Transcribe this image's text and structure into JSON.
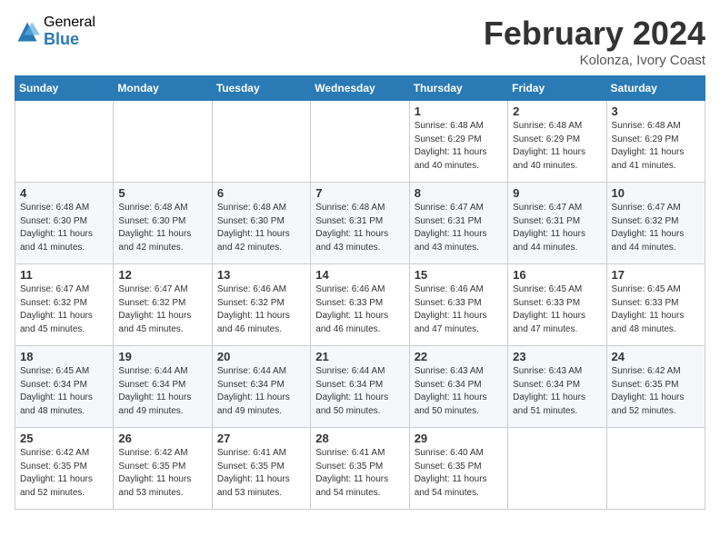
{
  "logo": {
    "general": "General",
    "blue": "Blue"
  },
  "title": "February 2024",
  "subtitle": "Kolonza, Ivory Coast",
  "days_header": [
    "Sunday",
    "Monday",
    "Tuesday",
    "Wednesday",
    "Thursday",
    "Friday",
    "Saturday"
  ],
  "weeks": [
    [
      {
        "day": "",
        "info": ""
      },
      {
        "day": "",
        "info": ""
      },
      {
        "day": "",
        "info": ""
      },
      {
        "day": "",
        "info": ""
      },
      {
        "day": "1",
        "info": "Sunrise: 6:48 AM\nSunset: 6:29 PM\nDaylight: 11 hours\nand 40 minutes."
      },
      {
        "day": "2",
        "info": "Sunrise: 6:48 AM\nSunset: 6:29 PM\nDaylight: 11 hours\nand 40 minutes."
      },
      {
        "day": "3",
        "info": "Sunrise: 6:48 AM\nSunset: 6:29 PM\nDaylight: 11 hours\nand 41 minutes."
      }
    ],
    [
      {
        "day": "4",
        "info": "Sunrise: 6:48 AM\nSunset: 6:30 PM\nDaylight: 11 hours\nand 41 minutes."
      },
      {
        "day": "5",
        "info": "Sunrise: 6:48 AM\nSunset: 6:30 PM\nDaylight: 11 hours\nand 42 minutes."
      },
      {
        "day": "6",
        "info": "Sunrise: 6:48 AM\nSunset: 6:30 PM\nDaylight: 11 hours\nand 42 minutes."
      },
      {
        "day": "7",
        "info": "Sunrise: 6:48 AM\nSunset: 6:31 PM\nDaylight: 11 hours\nand 43 minutes."
      },
      {
        "day": "8",
        "info": "Sunrise: 6:47 AM\nSunset: 6:31 PM\nDaylight: 11 hours\nand 43 minutes."
      },
      {
        "day": "9",
        "info": "Sunrise: 6:47 AM\nSunset: 6:31 PM\nDaylight: 11 hours\nand 44 minutes."
      },
      {
        "day": "10",
        "info": "Sunrise: 6:47 AM\nSunset: 6:32 PM\nDaylight: 11 hours\nand 44 minutes."
      }
    ],
    [
      {
        "day": "11",
        "info": "Sunrise: 6:47 AM\nSunset: 6:32 PM\nDaylight: 11 hours\nand 45 minutes."
      },
      {
        "day": "12",
        "info": "Sunrise: 6:47 AM\nSunset: 6:32 PM\nDaylight: 11 hours\nand 45 minutes."
      },
      {
        "day": "13",
        "info": "Sunrise: 6:46 AM\nSunset: 6:32 PM\nDaylight: 11 hours\nand 46 minutes."
      },
      {
        "day": "14",
        "info": "Sunrise: 6:46 AM\nSunset: 6:33 PM\nDaylight: 11 hours\nand 46 minutes."
      },
      {
        "day": "15",
        "info": "Sunrise: 6:46 AM\nSunset: 6:33 PM\nDaylight: 11 hours\nand 47 minutes."
      },
      {
        "day": "16",
        "info": "Sunrise: 6:45 AM\nSunset: 6:33 PM\nDaylight: 11 hours\nand 47 minutes."
      },
      {
        "day": "17",
        "info": "Sunrise: 6:45 AM\nSunset: 6:33 PM\nDaylight: 11 hours\nand 48 minutes."
      }
    ],
    [
      {
        "day": "18",
        "info": "Sunrise: 6:45 AM\nSunset: 6:34 PM\nDaylight: 11 hours\nand 48 minutes."
      },
      {
        "day": "19",
        "info": "Sunrise: 6:44 AM\nSunset: 6:34 PM\nDaylight: 11 hours\nand 49 minutes."
      },
      {
        "day": "20",
        "info": "Sunrise: 6:44 AM\nSunset: 6:34 PM\nDaylight: 11 hours\nand 49 minutes."
      },
      {
        "day": "21",
        "info": "Sunrise: 6:44 AM\nSunset: 6:34 PM\nDaylight: 11 hours\nand 50 minutes."
      },
      {
        "day": "22",
        "info": "Sunrise: 6:43 AM\nSunset: 6:34 PM\nDaylight: 11 hours\nand 50 minutes."
      },
      {
        "day": "23",
        "info": "Sunrise: 6:43 AM\nSunset: 6:34 PM\nDaylight: 11 hours\nand 51 minutes."
      },
      {
        "day": "24",
        "info": "Sunrise: 6:42 AM\nSunset: 6:35 PM\nDaylight: 11 hours\nand 52 minutes."
      }
    ],
    [
      {
        "day": "25",
        "info": "Sunrise: 6:42 AM\nSunset: 6:35 PM\nDaylight: 11 hours\nand 52 minutes."
      },
      {
        "day": "26",
        "info": "Sunrise: 6:42 AM\nSunset: 6:35 PM\nDaylight: 11 hours\nand 53 minutes."
      },
      {
        "day": "27",
        "info": "Sunrise: 6:41 AM\nSunset: 6:35 PM\nDaylight: 11 hours\nand 53 minutes."
      },
      {
        "day": "28",
        "info": "Sunrise: 6:41 AM\nSunset: 6:35 PM\nDaylight: 11 hours\nand 54 minutes."
      },
      {
        "day": "29",
        "info": "Sunrise: 6:40 AM\nSunset: 6:35 PM\nDaylight: 11 hours\nand 54 minutes."
      },
      {
        "day": "",
        "info": ""
      },
      {
        "day": "",
        "info": ""
      }
    ]
  ]
}
